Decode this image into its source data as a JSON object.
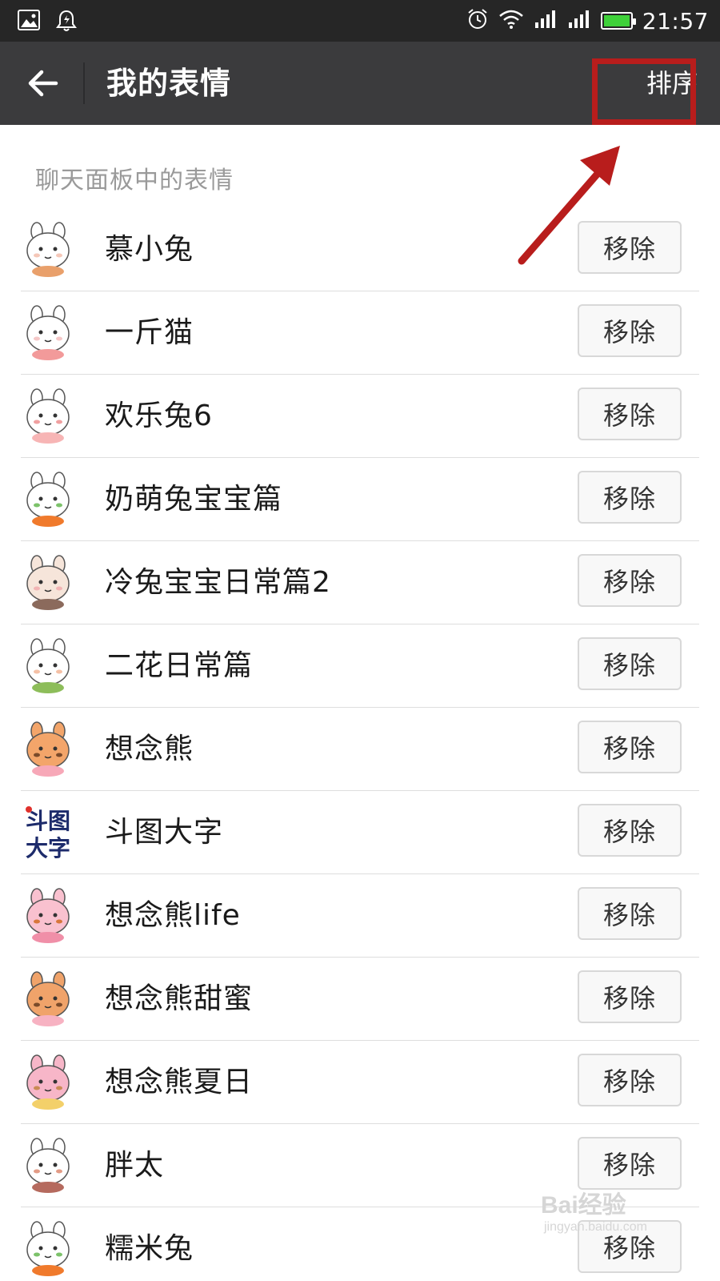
{
  "status_bar": {
    "time": "21:57",
    "icons": [
      "image-icon",
      "notification-bell-icon",
      "alarm-icon",
      "wifi-icon",
      "signal-icon",
      "signal-icon",
      "battery-icon"
    ],
    "battery_color": "#3fd13a"
  },
  "title_bar": {
    "title": "我的表情",
    "sort_label": "排序",
    "background": "#3b3b3d",
    "highlight_color": "#b81d1c"
  },
  "section_header": "聊天面板中的表情",
  "remove_label": "移除",
  "items": [
    {
      "name": "慕小兔",
      "icon": "bunny-sticker-icon"
    },
    {
      "name": "一斤猫",
      "icon": "cat-sticker-icon"
    },
    {
      "name": "欢乐兔6",
      "icon": "bunny-pig-sticker-icon"
    },
    {
      "name": "奶萌兔宝宝篇",
      "icon": "bunny-carrot-sticker-icon"
    },
    {
      "name": "冷兔宝宝日常篇2",
      "icon": "bunny-desk-sticker-icon"
    },
    {
      "name": "二花日常篇",
      "icon": "sprout-sticker-icon"
    },
    {
      "name": "想念熊",
      "icon": "bear-pig-sticker-icon"
    },
    {
      "name": "斗图大字",
      "icon": "text-logo-icon",
      "logo_text": "斗图大字"
    },
    {
      "name": "想念熊life",
      "icon": "pink-bear-sticker-icon"
    },
    {
      "name": "想念熊甜蜜",
      "icon": "bear-hug-sticker-icon"
    },
    {
      "name": "想念熊夏日",
      "icon": "bear-icecream-sticker-icon"
    },
    {
      "name": "胖太",
      "icon": "fox-cat-sticker-icon"
    },
    {
      "name": "糯米兔",
      "icon": "bunny-carrot-sticker-icon"
    }
  ],
  "watermark": {
    "main": "Bai经验",
    "sub": "jingyan.baidu.com"
  }
}
